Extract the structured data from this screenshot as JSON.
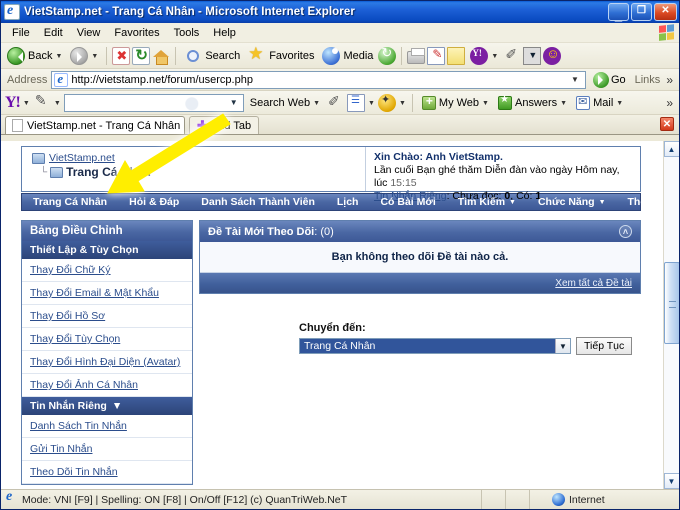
{
  "window": {
    "title": "VietStamp.net - Trang Cá Nhân - Microsoft Internet Explorer",
    "minimize_label": "_",
    "restore_label": "❐",
    "close_label": "✕"
  },
  "menubar": {
    "items": [
      {
        "label": "File"
      },
      {
        "label": "Edit"
      },
      {
        "label": "View"
      },
      {
        "label": "Favorites"
      },
      {
        "label": "Tools"
      },
      {
        "label": "Help"
      }
    ]
  },
  "toolbar": {
    "back_label": "Back",
    "search_label": "Search",
    "favorites_label": "Favorites",
    "media_label": "Media"
  },
  "addressbar": {
    "label": "Address",
    "url": "http://vietstamp.net/forum/usercp.php",
    "go_label": "Go",
    "links_label": "Links"
  },
  "yahoo_toolbar": {
    "logo": "Y!",
    "search_value": "",
    "search_web_label": "Search Web",
    "my_web_label": "My Web",
    "answers_label": "Answers",
    "mail_label": "Mail",
    "overflow_label": "»"
  },
  "tabbar": {
    "tabs": [
      {
        "label": "VietStamp.net - Trang Cá Nhân"
      }
    ],
    "add_tab_label": "Add Tab",
    "close_label": "✕"
  },
  "page": {
    "breadcrumb": {
      "root": "VietStamp.net",
      "current": "Trang Cá Nhân"
    },
    "greeting": {
      "hello": "Xin Chào: Anh VietStamp.",
      "last_visit_prefix": "Lần cuối Bạn ghé thăm Diễn đàn vào ngày Hôm nay, lúc ",
      "last_visit_time": "15:15",
      "pm_link": "Tin Nhắn Riêng",
      "pm_unread_label": ": Chưa đọc: ",
      "pm_unread_count": "0",
      "pm_total_label": ", Có: ",
      "pm_total_count": "1",
      "pm_suffix": "."
    },
    "nav": [
      {
        "label": "Trang Cá Nhân",
        "has_caret": false
      },
      {
        "label": "Hỏi & Đáp",
        "has_caret": false
      },
      {
        "label": "Danh Sách Thành Viên",
        "has_caret": false
      },
      {
        "label": "Lịch",
        "has_caret": false
      },
      {
        "label": "Có Bài Mới",
        "has_caret": false
      },
      {
        "label": "Tìm Kiếm",
        "has_caret": true
      },
      {
        "label": "Chức Năng",
        "has_caret": true
      },
      {
        "label": "Thoát",
        "has_caret": false
      }
    ],
    "sidebar": {
      "title": "Bảng Điều Chỉnh",
      "section1": "Thiết Lập & Tùy Chọn",
      "links1": [
        {
          "label": "Thay Đổi Chữ Ký"
        },
        {
          "label": "Thay Đổi Email & Mật Khẩu"
        },
        {
          "label": "Thay Đổi Hồ Sơ"
        },
        {
          "label": "Thay Đổi Tùy Chọn"
        },
        {
          "label": "Thay Đổi Hình Đại Diện (Avatar)"
        },
        {
          "label": "Thay Đổi Ảnh Cá Nhân"
        }
      ],
      "section2": "Tin Nhắn Riêng",
      "section2_caret": "▼",
      "links2": [
        {
          "label": "Danh Sách Tin Nhắn"
        },
        {
          "label": "Gửi Tin Nhắn"
        },
        {
          "label": "Theo Dõi Tin Nhắn"
        }
      ]
    },
    "panel": {
      "title": "Đề Tài Mới Theo Dõi",
      "count": ": (0)",
      "collapse_icon": "˄",
      "empty_message": "Bạn không theo dõi Đề tài nào cả.",
      "footer_link": "Xem tất cả Đề tài"
    },
    "jump": {
      "label": "Chuyển đến:",
      "selected": "Trang Cá Nhân",
      "arrow": "▼",
      "button": "Tiếp Tục"
    }
  },
  "statusbar": {
    "text": "Mode: VNI [F9] | Spelling: ON [F8] | On/Off [F12] (c) QuanTriWeb.NeT",
    "zone": "Internet"
  },
  "colors": {
    "title_blue": "#0a4bc0",
    "forum_blue": "#4a67a3",
    "forum_dark": "#2c4478",
    "link_blue": "#2b4d8c",
    "arrow_yellow": "#ffee00"
  }
}
